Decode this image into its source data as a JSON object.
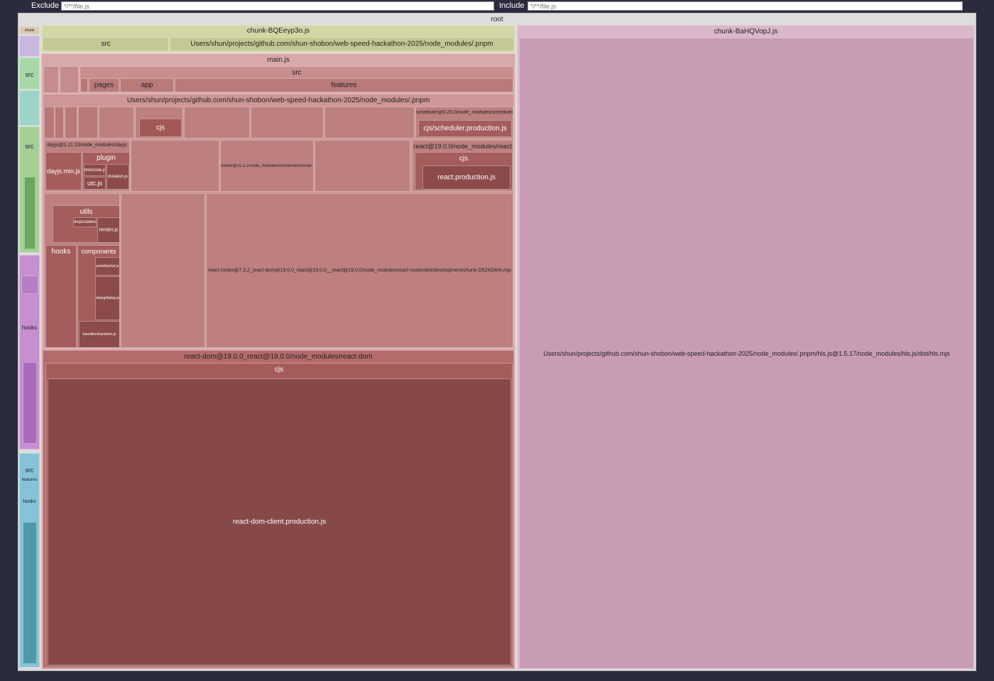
{
  "filters": {
    "exclude_label": "Exclude",
    "exclude_placeholder": "*/**/file.js",
    "include_label": "Include",
    "include_placeholder": "*/**/file.js"
  },
  "treemap": {
    "root": "root",
    "chunk_bq": "chunk-BQEeyp3o.js",
    "chunk_bq_src": "src",
    "chunk_bq_pnpm": "Users/shun/projects/github.com/shun-shobon/web-speed-hackathon-2025/node_modules/.pnpm",
    "main": "main.js",
    "main_src": "src",
    "pages": "pages",
    "app": "app",
    "features": "features",
    "main_pnpm": "Users/shun/projects/github.com/shun-shobon/web-speed-hackathon-2025/node_modules/.pnpm",
    "cjs_a": "cjs",
    "scheduler": "scheduler@0.25.0/node_modules/scheduler",
    "scheduler_cjs": "cjs/scheduler.production.js",
    "dayjs": "dayjs@1.11.13/node_modules/dayjs",
    "dayjs_min": "dayjs.min.js",
    "plugin": "plugin",
    "timezone": "timezone.js",
    "utc": "utc.js",
    "duration": "duration.js",
    "immer": "immer@10.1.1/node_modules/immer/dist/immer.mjs",
    "react_pkg": "react@19.0.0/node_modules/react",
    "react_cjs": "cjs",
    "react_prod": "react.production.js",
    "utils": "utils",
    "disposables": "disposables.js",
    "render": "render.js",
    "hooks": "hooks",
    "components": "components",
    "portal": "portal/portal.js",
    "dialog": "dialog/dialog.js",
    "transition": "transition/transition.js",
    "react_router": "react-router@7.3.2_react-dom@19.0.0_react@19.0.0__react@19.0.0/node_modules/react-router/dist/development/chunk-D52XG6IA.mjs",
    "react_dom_pkg": "react-dom@19.0.0_react@19.0.0/node_modules/react-dom",
    "react_dom_cjs": "cjs",
    "react_dom_client": "react-dom-client.production.js",
    "chunk_ba": "chunk-BaHQVopJ.js",
    "hls": "Users/shun/projects/github.com/shun-shobon/web-speed-hackathon-2025/node_modules/.pnpm/hls.js@1.5.17/node_modules/hls.js/dist/hls.mjs",
    "left_src_1": "src",
    "left_src_2": "src",
    "left_hooks_1": "hooks",
    "left_src_3": "src",
    "left_features": "features",
    "left_hooks_2": "hooks"
  },
  "colors": {
    "background": "#2a2c3e",
    "root": "#dedcdc",
    "chunk_bq": "#d3d7a8",
    "main": "#d9a9a9",
    "react_dom": "#864848",
    "chunk_ba": "#c99cb6"
  }
}
